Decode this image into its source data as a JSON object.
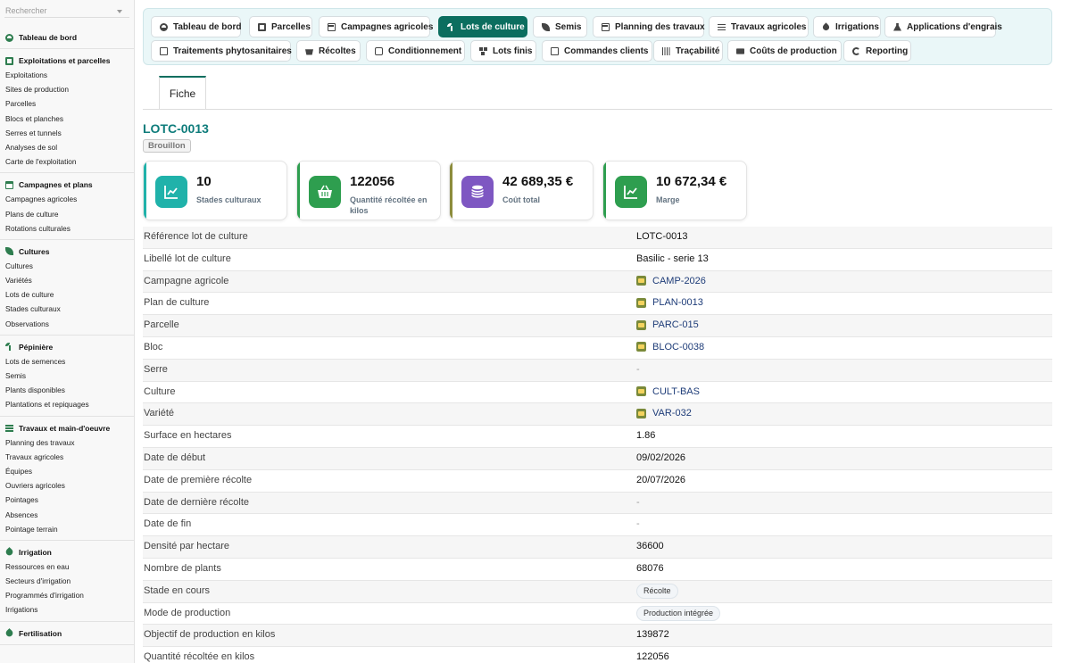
{
  "search": {
    "placeholder": "Rechercher"
  },
  "sidebar": {
    "groups": [
      {
        "title": "Tableau de bord",
        "icon": "dashboard-icon",
        "items": []
      },
      {
        "title": "Exploitations et parcelles",
        "icon": "farm-icon",
        "items": [
          "Exploitations",
          "Sites de production",
          "Parcelles",
          "Blocs et planches",
          "Serres et tunnels",
          "Analyses de sol",
          "Carte de l'exploitation"
        ]
      },
      {
        "title": "Campagnes et plans",
        "icon": "calendar-icon",
        "items": [
          "Campagnes agricoles",
          "Plans de culture",
          "Rotations culturales"
        ]
      },
      {
        "title": "Cultures",
        "icon": "leaf-icon",
        "items": [
          "Cultures",
          "Variétés",
          "Lots de culture",
          "Stades culturaux",
          "Observations"
        ]
      },
      {
        "title": "Pépinière",
        "icon": "sprout-icon",
        "items": [
          "Lots de semences",
          "Semis",
          "Plants disponibles",
          "Plantations et repiquages"
        ]
      },
      {
        "title": "Travaux et main-d'oeuvre",
        "icon": "list-icon",
        "items": [
          "Planning des travaux",
          "Travaux agricoles",
          "Équipes",
          "Ouvriers agricoles",
          "Pointages",
          "Absences",
          "Pointage terrain"
        ]
      },
      {
        "title": "Irrigation",
        "icon": "drop-icon",
        "items": [
          "Ressources en eau",
          "Secteurs d'irrigation",
          "Programmés d'irrigation",
          "Irrigations"
        ]
      },
      {
        "title": "Fertilisation",
        "icon": "flask-icon",
        "items": []
      }
    ]
  },
  "tabs": [
    {
      "label": "Tableau de bord",
      "icon": "dashboard-icon",
      "active": false
    },
    {
      "label": "Parcelles",
      "icon": "farm-icon",
      "active": false
    },
    {
      "label": "Campagnes agricoles",
      "icon": "calendar-icon",
      "active": false
    },
    {
      "label": "Lots de culture",
      "icon": "sprout-icon",
      "active": true
    },
    {
      "label": "Semis",
      "icon": "leaf-icon",
      "active": false
    },
    {
      "label": "Planning des travaux",
      "icon": "calendar-icon",
      "active": false
    },
    {
      "label": "Travaux agricoles",
      "icon": "list-icon",
      "active": false
    },
    {
      "label": "Irrigations",
      "icon": "drop-icon",
      "active": false
    },
    {
      "label": "Applications d'engrais",
      "icon": "flask-icon",
      "active": false
    },
    {
      "label": "Traitements phytosanitaires",
      "icon": "spray-icon",
      "active": false
    },
    {
      "label": "Récoltes",
      "icon": "basket-icon",
      "active": false
    },
    {
      "label": "Conditionnement",
      "icon": "box-icon",
      "active": false
    },
    {
      "label": "Lots finis",
      "icon": "pallet-icon",
      "active": false
    },
    {
      "label": "Commandes clients",
      "icon": "document-icon",
      "active": false
    },
    {
      "label": "Traçabilité",
      "icon": "barcode-icon",
      "active": false
    },
    {
      "label": "Coûts de production",
      "icon": "money-icon",
      "active": false
    },
    {
      "label": "Reporting",
      "icon": "chart-pie-icon",
      "active": false
    }
  ],
  "record": {
    "tab": "Fiche",
    "title": "LOTC-0013",
    "status": "Brouillon"
  },
  "kpis": [
    {
      "value": "10",
      "label": "Stades culturaux",
      "color": "#20b2aa",
      "bar": "#20b2aa"
    },
    {
      "value": "122056",
      "label": "Quantité récoltée en kilos",
      "color": "#2e9e4f",
      "bar": "#2e9e4f"
    },
    {
      "value": "42 689,35 €",
      "label": "Coût total",
      "color": "#7e57c2",
      "bar": "#8c8c3c"
    },
    {
      "value": "10 672,34 €",
      "label": "Marge",
      "color": "#2e9e4f",
      "bar": "#2e9e4f"
    }
  ],
  "details": [
    {
      "label": "Référence lot de culture",
      "value": "LOTC-0013",
      "type": "text"
    },
    {
      "label": "Libellé lot de culture",
      "value": "Basilic - serie 13",
      "type": "text"
    },
    {
      "label": "Campagne agricole",
      "value": "CAMP-2026",
      "type": "link"
    },
    {
      "label": "Plan de culture",
      "value": "PLAN-0013",
      "type": "link"
    },
    {
      "label": "Parcelle",
      "value": "PARC-015",
      "type": "link"
    },
    {
      "label": "Bloc",
      "value": "BLOC-0038",
      "type": "link"
    },
    {
      "label": "Serre",
      "value": "-",
      "type": "dash"
    },
    {
      "label": "Culture",
      "value": "CULT-BAS",
      "type": "link"
    },
    {
      "label": "Variété",
      "value": "VAR-032",
      "type": "link"
    },
    {
      "label": "Surface en hectares",
      "value": "1.86",
      "type": "text"
    },
    {
      "label": "Date de début",
      "value": "09/02/2026",
      "type": "text"
    },
    {
      "label": "Date de première récolte",
      "value": "20/07/2026",
      "type": "text"
    },
    {
      "label": "Date de dernière récolte",
      "value": "-",
      "type": "dash"
    },
    {
      "label": "Date de fin",
      "value": "-",
      "type": "dash"
    },
    {
      "label": "Densité par hectare",
      "value": "36600",
      "type": "text"
    },
    {
      "label": "Nombre de plants",
      "value": "68076",
      "type": "text"
    },
    {
      "label": "Stade en cours",
      "value": "Récolte",
      "type": "pill"
    },
    {
      "label": "Mode de production",
      "value": "Production intégrée",
      "type": "pill"
    },
    {
      "label": "Objectif de production en kilos",
      "value": "139872",
      "type": "text"
    },
    {
      "label": "Quantité récoltée en kilos",
      "value": "122056",
      "type": "text"
    }
  ]
}
